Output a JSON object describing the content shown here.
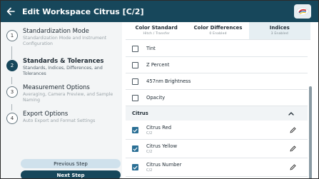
{
  "header": {
    "back_icon": "arrow-left-icon",
    "title": "Edit Workspace Citrus [C/2]",
    "logo_icon": "color-brand-logo-icon",
    "bg_color": "#17475b"
  },
  "steps": [
    {
      "number": "1",
      "title": "Standardization Mode",
      "description": "Standardization Mode and Instrument Configuration",
      "active": false
    },
    {
      "number": "2",
      "title": "Standards & Tolerances",
      "description": "Standards, Indices, Differences, and Tolerances",
      "active": true
    },
    {
      "number": "3",
      "title": "Measurement Options",
      "description": "Averaging, Camera Preview, and Sample Naming",
      "active": false
    },
    {
      "number": "4",
      "title": "Export Options",
      "description": "Auto Export and Format Settings",
      "active": false
    }
  ],
  "buttons": {
    "previous": "Previous Step",
    "next": "Next Step"
  },
  "tabs": [
    {
      "label": "Color Standard",
      "sub": "Hitch / Transfer",
      "active": false
    },
    {
      "label": "Color Differences",
      "sub": "0 Enabled",
      "active": false
    },
    {
      "label": "Indices",
      "sub": "3 Enabled",
      "active": true
    }
  ],
  "list": {
    "unchecked_items": [
      "Tint",
      "Z Percent",
      "457nm Brightness",
      "Opacity"
    ],
    "group": {
      "title": "Citrus",
      "caret_icon": "chevron-up-icon",
      "items": [
        {
          "name": "Citrus Red",
          "sub": "C/2",
          "checked": true,
          "edit_icon": "pencil-icon"
        },
        {
          "name": "Citrus Yellow",
          "sub": "C/2",
          "checked": true,
          "edit_icon": "pencil-icon"
        },
        {
          "name": "Citrus Number",
          "sub": "C/2",
          "checked": true,
          "edit_icon": "pencil-icon"
        }
      ]
    }
  },
  "colors": {
    "accent": "#17475b",
    "checkbox": "#2a6f95",
    "secondary_button": "#cfe1ec"
  }
}
